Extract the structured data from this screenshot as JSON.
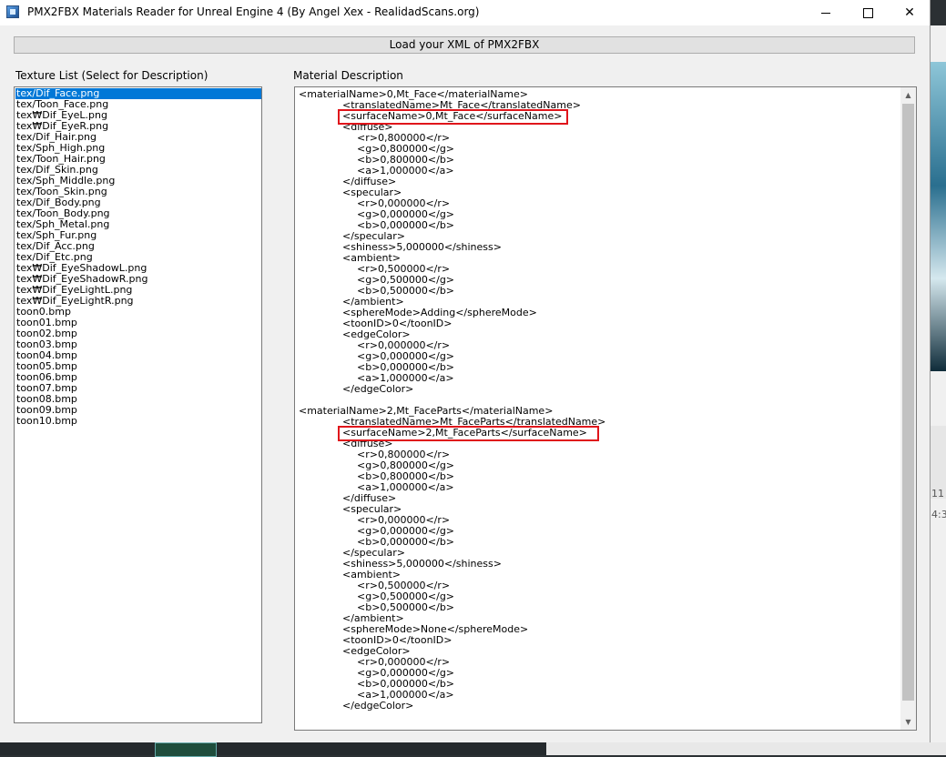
{
  "window": {
    "title": "PMX2FBX Materials Reader for Unreal Engine 4 (By Angel Xex - RealidadScans.org)"
  },
  "toolbar": {
    "load_label": "Load your XML of PMX2FBX"
  },
  "texture_list": {
    "label": "Texture List (Select for Description)",
    "selected_index": 0,
    "items": [
      "tex/Dif_Face.png",
      "tex/Toon_Face.png",
      "tex₩Dif_EyeL.png",
      "tex₩Dif_EyeR.png",
      "tex/Dif_Hair.png",
      "tex/Sph_High.png",
      "tex/Toon_Hair.png",
      "tex/Dif_Skin.png",
      "tex/Sph_Middle.png",
      "tex/Toon_Skin.png",
      "tex/Dif_Body.png",
      "tex/Toon_Body.png",
      "tex/Sph_Metal.png",
      "tex/Sph_Fur.png",
      "tex/Dif_Acc.png",
      "tex/Dif_Etc.png",
      "tex₩Dif_EyeShadowL.png",
      "tex₩Dif_EyeShadowR.png",
      "tex₩Dif_EyeLightL.png",
      "tex₩Dif_EyeLightR.png",
      "toon0.bmp",
      "toon01.bmp",
      "toon02.bmp",
      "toon03.bmp",
      "toon04.bmp",
      "toon05.bmp",
      "toon06.bmp",
      "toon07.bmp",
      "toon08.bmp",
      "toon09.bmp",
      "toon10.bmp"
    ]
  },
  "material_description": {
    "label": "Material Description",
    "lines": [
      {
        "i": 0,
        "t": "<materialName>0,Mt_Face</materialName>"
      },
      {
        "i": 1,
        "t": "<translatedName>Mt_Face</translatedName>"
      },
      {
        "i": 1,
        "t": "<surfaceName>0,Mt_Face</surfaceName>"
      },
      {
        "i": 1,
        "t": "<diffuse>"
      },
      {
        "i": 2,
        "t": "<r>0,800000</r>"
      },
      {
        "i": 2,
        "t": "<g>0,800000</g>"
      },
      {
        "i": 2,
        "t": "<b>0,800000</b>"
      },
      {
        "i": 2,
        "t": "<a>1,000000</a>"
      },
      {
        "i": 1,
        "t": "</diffuse>"
      },
      {
        "i": 1,
        "t": "<specular>"
      },
      {
        "i": 2,
        "t": "<r>0,000000</r>"
      },
      {
        "i": 2,
        "t": "<g>0,000000</g>"
      },
      {
        "i": 2,
        "t": "<b>0,000000</b>"
      },
      {
        "i": 1,
        "t": "</specular>"
      },
      {
        "i": 1,
        "t": "<shiness>5,000000</shiness>"
      },
      {
        "i": 1,
        "t": "<ambient>"
      },
      {
        "i": 2,
        "t": "<r>0,500000</r>"
      },
      {
        "i": 2,
        "t": "<g>0,500000</g>"
      },
      {
        "i": 2,
        "t": "<b>0,500000</b>"
      },
      {
        "i": 1,
        "t": "</ambient>"
      },
      {
        "i": 1,
        "t": "<sphereMode>Adding</sphereMode>"
      },
      {
        "i": 1,
        "t": "<toonID>0</toonID>"
      },
      {
        "i": 1,
        "t": "<edgeColor>"
      },
      {
        "i": 2,
        "t": "<r>0,000000</r>"
      },
      {
        "i": 2,
        "t": "<g>0,000000</g>"
      },
      {
        "i": 2,
        "t": "<b>0,000000</b>"
      },
      {
        "i": 2,
        "t": "<a>1,000000</a>"
      },
      {
        "i": 1,
        "t": "</edgeColor>"
      },
      {
        "i": 0,
        "t": ""
      },
      {
        "i": 0,
        "t": "<materialName>2,Mt_FaceParts</materialName>"
      },
      {
        "i": 1,
        "t": "<translatedName>Mt_FaceParts</translatedName>"
      },
      {
        "i": 1,
        "t": "<surfaceName>2,Mt_FaceParts</surfaceName>"
      },
      {
        "i": 1,
        "t": "<diffuse>"
      },
      {
        "i": 2,
        "t": "<r>0,800000</r>"
      },
      {
        "i": 2,
        "t": "<g>0,800000</g>"
      },
      {
        "i": 2,
        "t": "<b>0,800000</b>"
      },
      {
        "i": 2,
        "t": "<a>1,000000</a>"
      },
      {
        "i": 1,
        "t": "</diffuse>"
      },
      {
        "i": 1,
        "t": "<specular>"
      },
      {
        "i": 2,
        "t": "<r>0,000000</r>"
      },
      {
        "i": 2,
        "t": "<g>0,000000</g>"
      },
      {
        "i": 2,
        "t": "<b>0,000000</b>"
      },
      {
        "i": 1,
        "t": "</specular>"
      },
      {
        "i": 1,
        "t": "<shiness>5,000000</shiness>"
      },
      {
        "i": 1,
        "t": "<ambient>"
      },
      {
        "i": 2,
        "t": "<r>0,500000</r>"
      },
      {
        "i": 2,
        "t": "<g>0,500000</g>"
      },
      {
        "i": 2,
        "t": "<b>0,500000</b>"
      },
      {
        "i": 1,
        "t": "</ambient>"
      },
      {
        "i": 1,
        "t": "<sphereMode>None</sphereMode>"
      },
      {
        "i": 1,
        "t": "<toonID>0</toonID>"
      },
      {
        "i": 1,
        "t": "<edgeColor>"
      },
      {
        "i": 2,
        "t": "<r>0,000000</r>"
      },
      {
        "i": 2,
        "t": "<g>0,000000</g>"
      },
      {
        "i": 2,
        "t": "<b>0,000000</b>"
      },
      {
        "i": 2,
        "t": "<a>1,000000</a>"
      },
      {
        "i": 1,
        "t": "</edgeColor>"
      }
    ],
    "highlighted_line_indices": [
      2,
      31
    ]
  },
  "background": {
    "right_text_1": "11",
    "right_text_2": "4:3"
  },
  "colors": {
    "selection": "#0078d7",
    "highlight_box": "#e0151b"
  }
}
